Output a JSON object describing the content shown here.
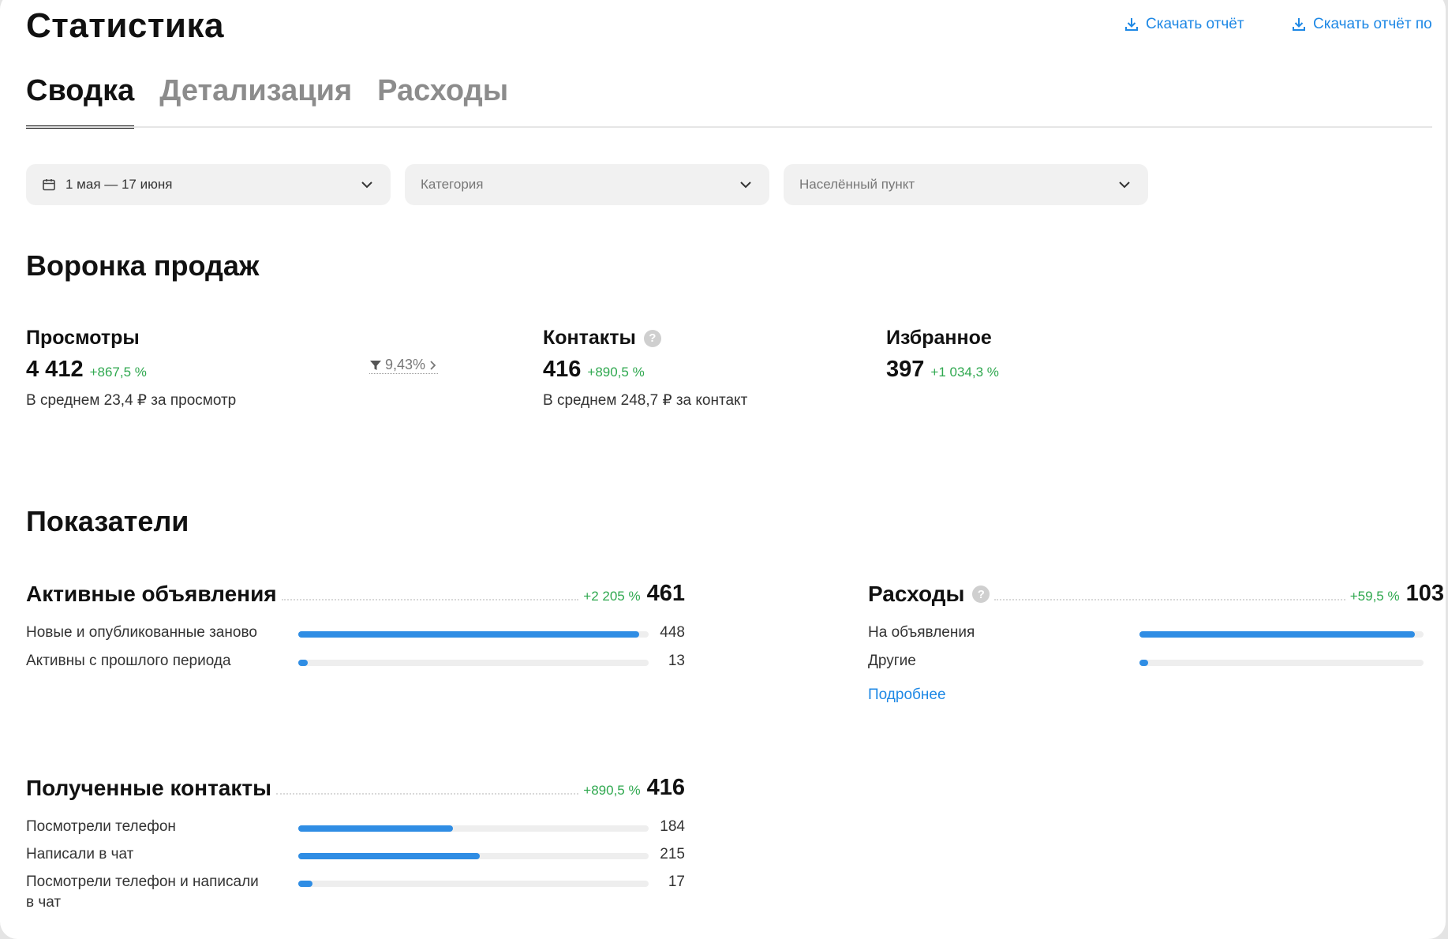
{
  "header": {
    "title": "Статистика",
    "download_report": "Скачать отчёт",
    "download_report_2": "Скачать отчёт по"
  },
  "tabs": [
    {
      "label": "Сводка",
      "active": true
    },
    {
      "label": "Детализация",
      "active": false
    },
    {
      "label": "Расходы",
      "active": false
    }
  ],
  "filters": {
    "period": "1 мая — 17 июня",
    "category_placeholder": "Категория",
    "city_placeholder": "Населённый пункт"
  },
  "funnel": {
    "title": "Воронка продаж",
    "views": {
      "label": "Просмотры",
      "value": "4 412",
      "delta": "+867,5 %",
      "sub": "В среднем 23,4 ₽ за просмотр"
    },
    "conversion": "9,43%",
    "contacts": {
      "label": "Контакты",
      "help": "?",
      "value": "416",
      "delta": "+890,5 %",
      "sub": "В среднем 248,7 ₽ за контакт"
    },
    "favorites": {
      "label": "Избранное",
      "value": "397",
      "delta": "+1 034,3 %"
    }
  },
  "indicators": {
    "title": "Показатели",
    "active_ads": {
      "label": "Активные объявления",
      "delta": "+2 205 %",
      "value": "461",
      "rows": [
        {
          "label": "Новые и опубликованные заново",
          "value": "448",
          "fraction": 0.972
        },
        {
          "label": "Активны с прошлого периода",
          "value": "13",
          "fraction": 0.028
        }
      ]
    },
    "expenses": {
      "label": "Расходы",
      "help": "?",
      "delta": "+59,5 %",
      "value": "103",
      "rows": [
        {
          "label": "На объявления",
          "fraction": 0.97
        },
        {
          "label": "Другие",
          "fraction": 0.03
        }
      ],
      "more": "Подробнее"
    },
    "contacts_received": {
      "label": "Полученные контакты",
      "delta": "+890,5 %",
      "value": "416",
      "rows": [
        {
          "label": "Посмотрели телефон",
          "value": "184",
          "fraction": 0.442
        },
        {
          "label": "Написали в чат",
          "value": "215",
          "fraction": 0.517
        },
        {
          "label": "Посмотрели телефон и написали",
          "label2": "в чат",
          "value": "17",
          "fraction": 0.041
        }
      ]
    }
  },
  "colors": {
    "accent": "#1e88e5",
    "bar": "#2f8de4",
    "positive": "#2fa84f",
    "track": "#eeeeee"
  }
}
